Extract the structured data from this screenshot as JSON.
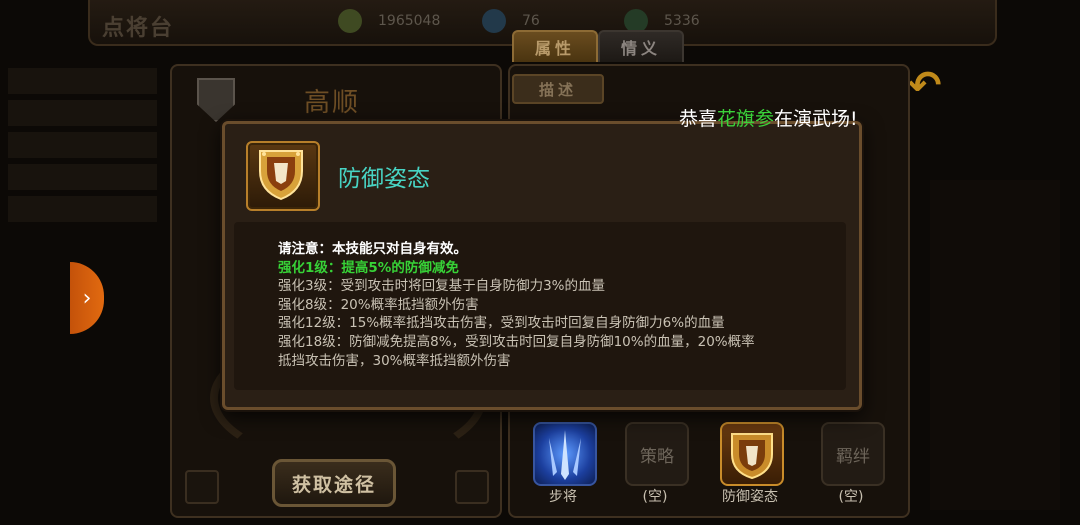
{
  "header": {
    "title": "点将台",
    "resources": [
      "1965048",
      "76",
      "5336"
    ]
  },
  "tabs": {
    "attributes": "属性",
    "bonds": "情义"
  },
  "hero": {
    "name": "高顺",
    "source_button": "获取途径"
  },
  "description_tab": "描述",
  "broadcast": {
    "prefix": "恭喜",
    "highlight": "花旗参",
    "suffix": "在演武场!"
  },
  "popup": {
    "skill_name": "防御姿态",
    "note": "请注意：本技能只对自身有效。",
    "lines": [
      {
        "text": "强化1级：提高5%的防御减免",
        "active": true
      },
      {
        "text": "强化3级：受到攻击时将回复基于自身防御力3%的血量",
        "active": false
      },
      {
        "text": "强化8级：20%概率抵挡额外伤害",
        "active": false
      },
      {
        "text": "强化12级：15%概率抵挡攻击伤害，受到攻击时回复自身防御力6%的血量",
        "active": false
      },
      {
        "text": "强化18级：防御减免提高8%，受到攻击时回复自身防御10%的血量，20%概率",
        "active": false
      },
      {
        "text": "抵挡攻击伤害，30%概率抵挡额外伤害",
        "active": false
      }
    ]
  },
  "skill_slots": [
    {
      "label": "步将",
      "icon": ""
    },
    {
      "label": "(空)",
      "icon": "策略"
    },
    {
      "label": "防御姿态",
      "icon": ""
    },
    {
      "label": "(空)",
      "icon": "羁绊"
    }
  ],
  "colors": {
    "accent_gold": "#c98c2a",
    "skill_title": "#48d4c4",
    "active_level": "#37d237",
    "side_tab": "#e26a10"
  }
}
